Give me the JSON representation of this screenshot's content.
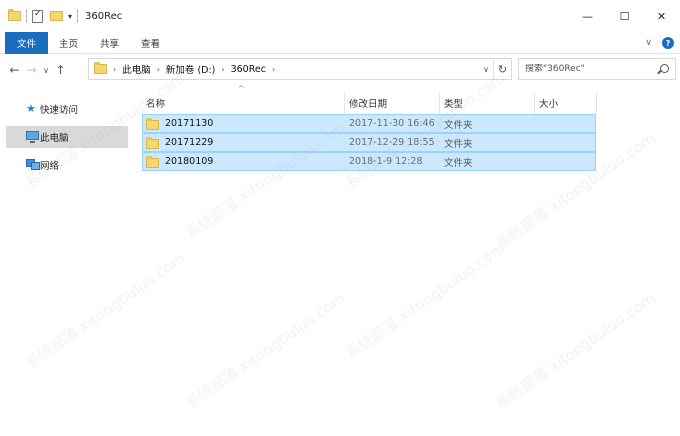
{
  "window": {
    "title": "360Rec",
    "qa_arrow": "▾",
    "controls": {
      "minimize": "—",
      "maximize": "☐",
      "close": "✕"
    }
  },
  "ribbon": {
    "tabs": [
      {
        "label": "文件",
        "active": true
      },
      {
        "label": "主页"
      },
      {
        "label": "共享"
      },
      {
        "label": "查看"
      }
    ],
    "expand": "∨",
    "help": "?"
  },
  "nav": {
    "back": "←",
    "forward": "→",
    "recent": "∨",
    "up": "↑",
    "breadcrumbs": [
      "此电脑",
      "新加卷 (D:)",
      "360Rec"
    ],
    "crumb_sep": "›",
    "dropdown": "∨",
    "refresh": "↻"
  },
  "search": {
    "placeholder": "搜索\"360Rec\""
  },
  "sidebar": {
    "items": [
      {
        "label": "快速访问",
        "icon": "star-icon"
      },
      {
        "label": "此电脑",
        "icon": "computer-icon",
        "selected": true
      },
      {
        "label": "网络",
        "icon": "network-icon"
      }
    ]
  },
  "list": {
    "sort_indicator": "^",
    "columns": [
      "名称",
      "修改日期",
      "类型",
      "大小"
    ],
    "rows": [
      {
        "name": "20171130",
        "date": "2017-11-30 16:46",
        "type": "文件夹"
      },
      {
        "name": "20171229",
        "date": "2017-12-29 18:55",
        "type": "文件夹"
      },
      {
        "name": "20180109",
        "date": "2018-1-9 12:28",
        "type": "文件夹"
      }
    ]
  },
  "watermark": "系统部落 xitongbuluo.com",
  "colors": {
    "accent": "#1a6ebd",
    "selection": "#cce8ff",
    "selection_border": "#99d1ff",
    "folder": "#f6d66e"
  }
}
